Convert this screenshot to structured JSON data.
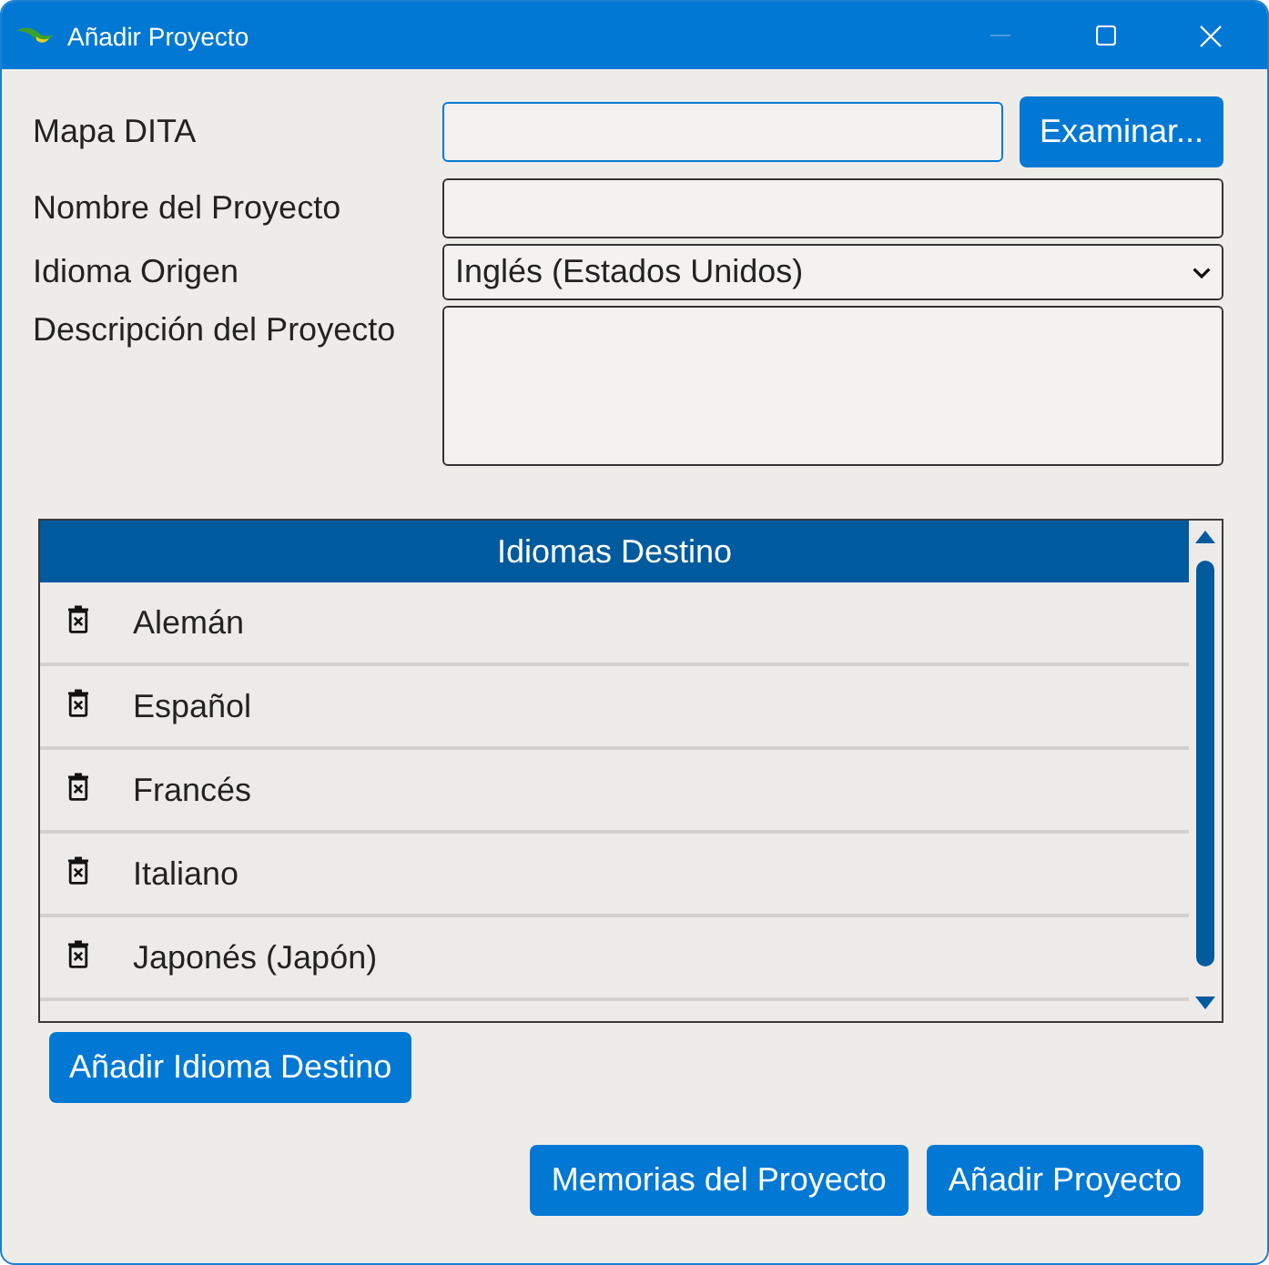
{
  "window": {
    "title": "Añadir Proyecto",
    "minimize_disabled": true
  },
  "form": {
    "fields": [
      {
        "kind": "file",
        "label": "Mapa DITA",
        "focused": true,
        "button": "Examinar..."
      },
      {
        "kind": "text",
        "label": "Nombre del Proyecto",
        "focused": false
      },
      {
        "kind": "select",
        "label": "Idioma Origen",
        "value": "Inglés (Estados Unidos)",
        "focused": false
      },
      {
        "kind": "textarea",
        "label": "Descripción del Proyecto",
        "focused": false
      }
    ]
  },
  "target_languages": {
    "title": "Idiomas Destino",
    "items": [
      {
        "name": "Alemán"
      },
      {
        "name": "Español"
      },
      {
        "name": "Francés"
      },
      {
        "name": "Italiano"
      },
      {
        "name": "Japonés (Japón)"
      }
    ],
    "add_button": "Añadir Idioma Destino"
  },
  "buttons": [
    "Memorias del Proyecto",
    "Añadir Proyecto"
  ]
}
